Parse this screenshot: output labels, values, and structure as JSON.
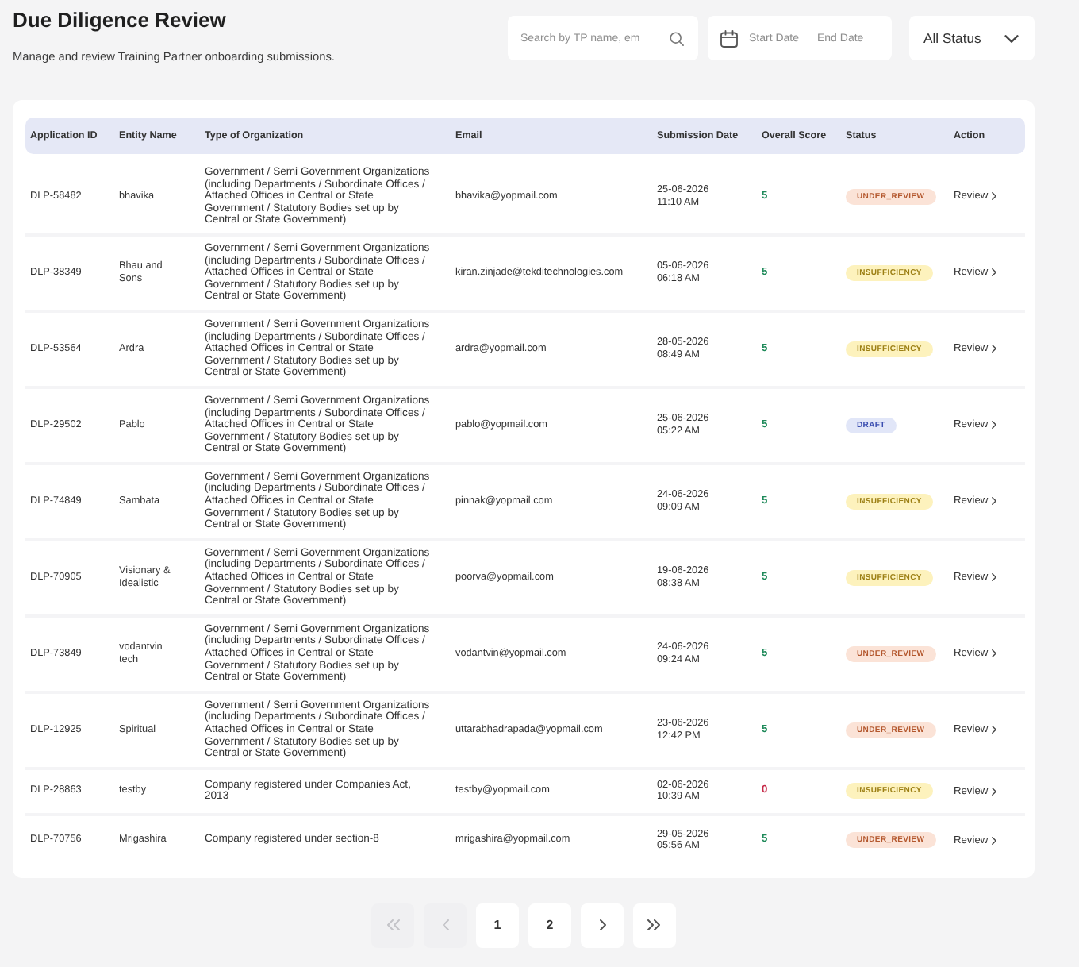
{
  "page": {
    "title": "Due Diligence Review",
    "subtitle": "Manage and review Training Partner onboarding submissions."
  },
  "filters": {
    "search": {
      "placeholder": "Search by TP name, em"
    },
    "date_range": {
      "start_placeholder": "Start Date",
      "end_placeholder": "End Date"
    },
    "status_select": {
      "value": "All Status"
    }
  },
  "table": {
    "columns": [
      "Application ID",
      "Entity Name",
      "Type of Organization",
      "Email",
      "Submission Date",
      "Overall Score",
      "Status",
      "Action"
    ],
    "rows": [
      {
        "application_id": "DLP-58482",
        "entity_name": "bhavika",
        "organization_type": "Government / Semi Government Organizations (including Departments / Subordinate Offices / Attached Offices in Central or State Government / Statutory Bodies set up by Central or State Government)",
        "email": "bhavika@yopmail.com",
        "submission_date": "25-06-2026 11:10 AM",
        "overall_score": {
          "text": "5",
          "color": "#1f8a5a"
        },
        "status": {
          "label": "UNDER_REVIEW",
          "kind": "under_review"
        },
        "action": "Review"
      },
      {
        "application_id": "DLP-38349",
        "entity_name": "Bhau and Sons",
        "organization_type": "Government / Semi Government Organizations (including Departments / Subordinate Offices / Attached Offices in Central or State Government / Statutory Bodies set up by Central or State Government)",
        "email": "kiran.zinjade@tekditechnologies.com",
        "submission_date": "05-06-2026 06:18 AM",
        "overall_score": {
          "text": "5",
          "color": "#1f8a5a"
        },
        "status": {
          "label": "INSUFFICIENCY",
          "kind": "insufficiency"
        },
        "action": "Review"
      },
      {
        "application_id": "DLP-53564",
        "entity_name": "Ardra",
        "organization_type": "Government / Semi Government Organizations (including Departments / Subordinate Offices / Attached Offices in Central or State Government / Statutory Bodies set up by Central or State Government)",
        "email": "ardra@yopmail.com",
        "submission_date": "28-05-2026 08:49 AM",
        "overall_score": {
          "text": "5",
          "color": "#1f8a5a"
        },
        "status": {
          "label": "INSUFFICIENCY",
          "kind": "insufficiency"
        },
        "action": "Review"
      },
      {
        "application_id": "DLP-29502",
        "entity_name": "Pablo",
        "organization_type": "Government / Semi Government Organizations (including Departments / Subordinate Offices / Attached Offices in Central or State Government / Statutory Bodies set up by Central or State Government)",
        "email": "pablo@yopmail.com",
        "submission_date": "25-06-2026 05:22 AM",
        "overall_score": {
          "text": "5",
          "color": "#1f8a5a"
        },
        "status": {
          "label": "DRAFT",
          "kind": "draft"
        },
        "action": "Review"
      },
      {
        "application_id": "DLP-74849",
        "entity_name": "Sambata",
        "organization_type": "Government / Semi Government Organizations (including Departments / Subordinate Offices / Attached Offices in Central or State Government / Statutory Bodies set up by Central or State Government)",
        "email": "pinnak@yopmail.com",
        "submission_date": "24-06-2026 09:09 AM",
        "overall_score": {
          "text": "5",
          "color": "#1f8a5a"
        },
        "status": {
          "label": "INSUFFICIENCY",
          "kind": "insufficiency"
        },
        "action": "Review"
      },
      {
        "application_id": "DLP-70905",
        "entity_name": "Visionary & Idealistic",
        "organization_type": "Government / Semi Government Organizations (including Departments / Subordinate Offices / Attached Offices in Central or State Government / Statutory Bodies set up by Central or State Government)",
        "email": "poorva@yopmail.com",
        "submission_date": "19-06-2026 08:38 AM",
        "overall_score": {
          "text": "5",
          "color": "#1f8a5a"
        },
        "status": {
          "label": "INSUFFICIENCY",
          "kind": "insufficiency"
        },
        "action": "Review"
      },
      {
        "application_id": "DLP-73849",
        "entity_name": "vodantvin tech",
        "organization_type": "Government / Semi Government Organizations (including Departments / Subordinate Offices / Attached Offices in Central or State Government / Statutory Bodies set up by Central or State Government)",
        "email": "vodantvin@yopmail.com",
        "submission_date": "24-06-2026 09:24 AM",
        "overall_score": {
          "text": "5",
          "color": "#1f8a5a"
        },
        "status": {
          "label": "UNDER_REVIEW",
          "kind": "under_review"
        },
        "action": "Review"
      },
      {
        "application_id": "DLP-12925",
        "entity_name": "Spiritual",
        "organization_type": "Government / Semi Government Organizations (including Departments / Subordinate Offices / Attached Offices in Central or State Government / Statutory Bodies set up by Central or State Government)",
        "email": "uttarabhadrapada@yopmail.com",
        "submission_date": "23-06-2026 12:42 PM",
        "overall_score": {
          "text": "5",
          "color": "#1f8a5a"
        },
        "status": {
          "label": "UNDER_REVIEW",
          "kind": "under_review"
        },
        "action": "Review"
      },
      {
        "application_id": "DLP-28863",
        "entity_name": "testby",
        "organization_type": "Company registered under Companies Act, 2013",
        "email": "testby@yopmail.com",
        "submission_date": "02-06-2026 10:39 AM",
        "overall_score": {
          "text": "0",
          "color": "#c62847"
        },
        "status": {
          "label": "INSUFFICIENCY",
          "kind": "insufficiency"
        },
        "action": "Review"
      },
      {
        "application_id": "DLP-70756",
        "entity_name": "Mrigashira",
        "organization_type": "Company registered under section-8",
        "email": "mrigashira@yopmail.com",
        "submission_date": "29-05-2026 05:56 AM",
        "overall_score": {
          "text": "5",
          "color": "#1f8a5a"
        },
        "status": {
          "label": "UNDER_REVIEW",
          "kind": "under_review"
        },
        "action": "Review"
      }
    ]
  },
  "pagination": [
    {
      "kind": "first",
      "disabled": true
    },
    {
      "kind": "prev",
      "disabled": true
    },
    {
      "kind": "page",
      "label": "1",
      "disabled": false
    },
    {
      "kind": "page",
      "label": "2",
      "disabled": false
    },
    {
      "kind": "next",
      "disabled": false
    },
    {
      "kind": "last",
      "disabled": false
    }
  ]
}
